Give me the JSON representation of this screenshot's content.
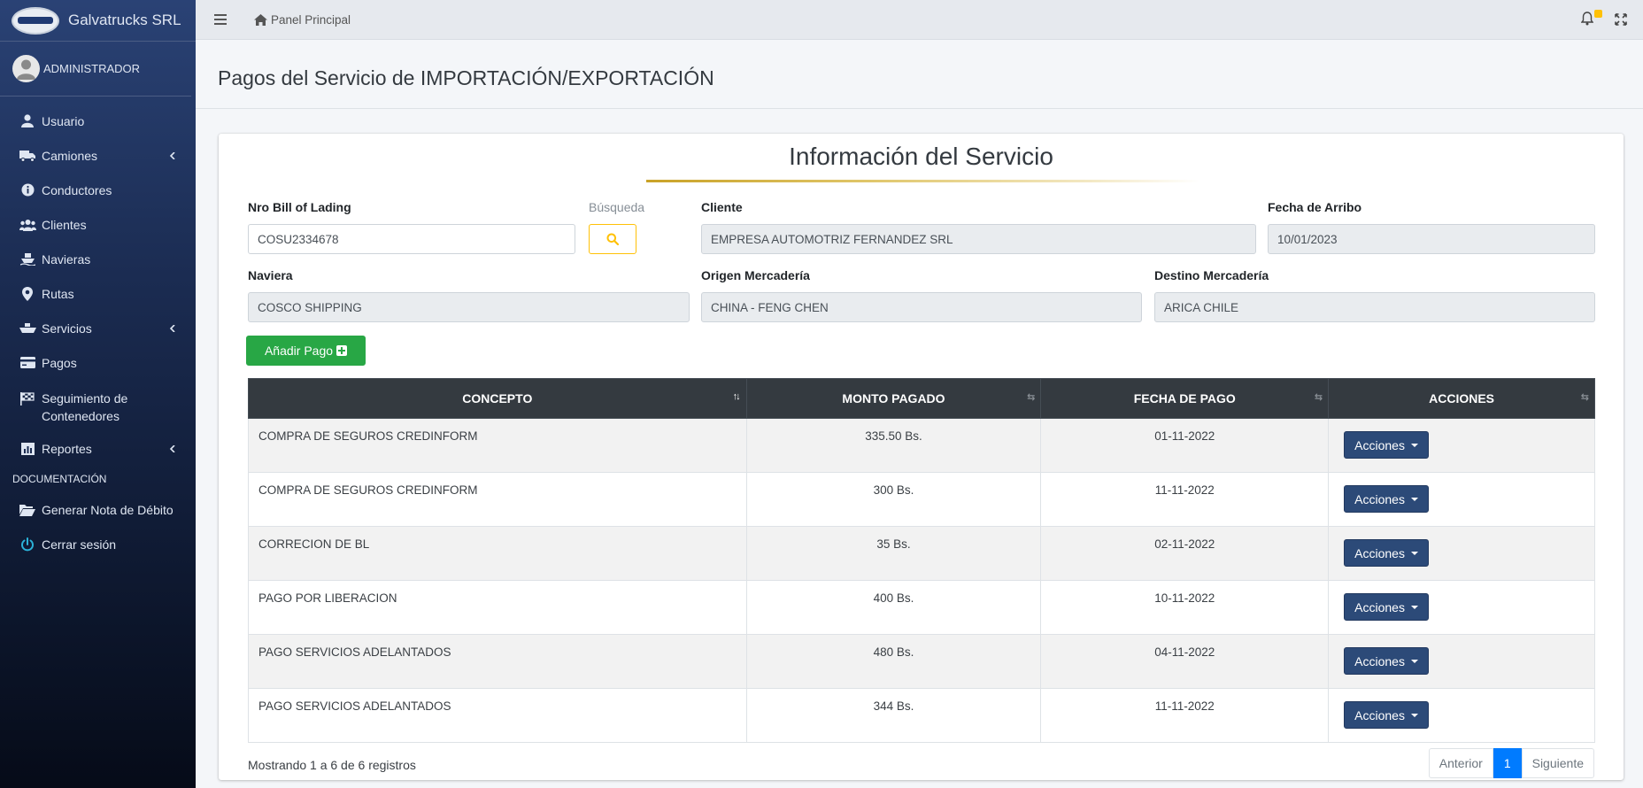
{
  "brand": {
    "name": "Galvatrucks SRL"
  },
  "user": {
    "name": "ADMINISTRADOR"
  },
  "sidebar": {
    "items": [
      {
        "label": "Usuario",
        "icon": "user-icon"
      },
      {
        "label": "Camiones",
        "icon": "truck-icon",
        "has_submenu": true
      },
      {
        "label": "Conductores",
        "icon": "info-circle-icon"
      },
      {
        "label": "Clientes",
        "icon": "users-icon"
      },
      {
        "label": "Navieras",
        "icon": "ship-icon"
      },
      {
        "label": "Rutas",
        "icon": "map-marker-icon"
      },
      {
        "label": "Servicios",
        "icon": "shipping-icon",
        "has_submenu": true
      },
      {
        "label": "Pagos",
        "icon": "credit-card-icon"
      },
      {
        "label": "Seguimiento de Contenedores",
        "icon": "flag-checkered-icon"
      },
      {
        "label": "Reportes",
        "icon": "chart-icon",
        "has_submenu": true
      }
    ],
    "section_header": "DOCUMENTACIÓN",
    "doc_items": [
      {
        "label": "Generar Nota de Débito",
        "icon": "folder-open-icon"
      },
      {
        "label": "Cerrar sesión",
        "icon": "power-icon"
      }
    ]
  },
  "topbar": {
    "breadcrumb": "Panel Principal",
    "notifications_count": ""
  },
  "page": {
    "title": "Pagos del Servicio de IMPORTACIÓN/EXPORTACIÓN"
  },
  "card": {
    "title": "Información del Servicio",
    "fields": {
      "bill_label": "Nro Bill of Lading",
      "bill_value": "COSU2334678",
      "search_label": "Búsqueda",
      "cliente_label": "Cliente",
      "cliente_value": "EMPRESA AUTOMOTRIZ FERNANDEZ SRL",
      "arribo_label": "Fecha de Arribo",
      "arribo_value": "10/01/2023",
      "naviera_label": "Naviera",
      "naviera_value": "COSCO SHIPPING",
      "origen_label": "Origen Mercadería",
      "origen_value": "CHINA - FENG CHEN",
      "destino_label": "Destino Mercadería",
      "destino_value": "ARICA CHILE"
    },
    "add_button": "Añadir Pago"
  },
  "table": {
    "headers": [
      "CONCEPTO",
      "MONTO PAGADO",
      "FECHA DE PAGO",
      "ACCIONES"
    ],
    "rows": [
      {
        "concepto": "COMPRA DE SEGUROS CREDINFORM",
        "monto": "335.50 Bs.",
        "fecha": "01-11-2022"
      },
      {
        "concepto": "COMPRA DE SEGUROS CREDINFORM",
        "monto": "300 Bs.",
        "fecha": "11-11-2022"
      },
      {
        "concepto": "CORRECION DE BL",
        "monto": "35 Bs.",
        "fecha": "02-11-2022"
      },
      {
        "concepto": "PAGO POR LIBERACION",
        "monto": "400 Bs.",
        "fecha": "10-11-2022"
      },
      {
        "concepto": "PAGO SERVICIOS ADELANTADOS",
        "monto": "480 Bs.",
        "fecha": "04-11-2022"
      },
      {
        "concepto": "PAGO SERVICIOS ADELANTADOS",
        "monto": "344 Bs.",
        "fecha": "11-11-2022"
      }
    ],
    "action_label": "Acciones",
    "info": "Mostrando 1 a 6 de 6 registros",
    "pagination": {
      "prev": "Anterior",
      "current": "1",
      "next": "Siguiente"
    }
  },
  "colors": {
    "sidebar_top": "#2a4275",
    "sidebar_bottom": "#060b18",
    "success": "#28a745",
    "warning": "#ffc107",
    "primary": "#007bff",
    "table_header": "#343a40",
    "action_button": "#2c4a78"
  }
}
